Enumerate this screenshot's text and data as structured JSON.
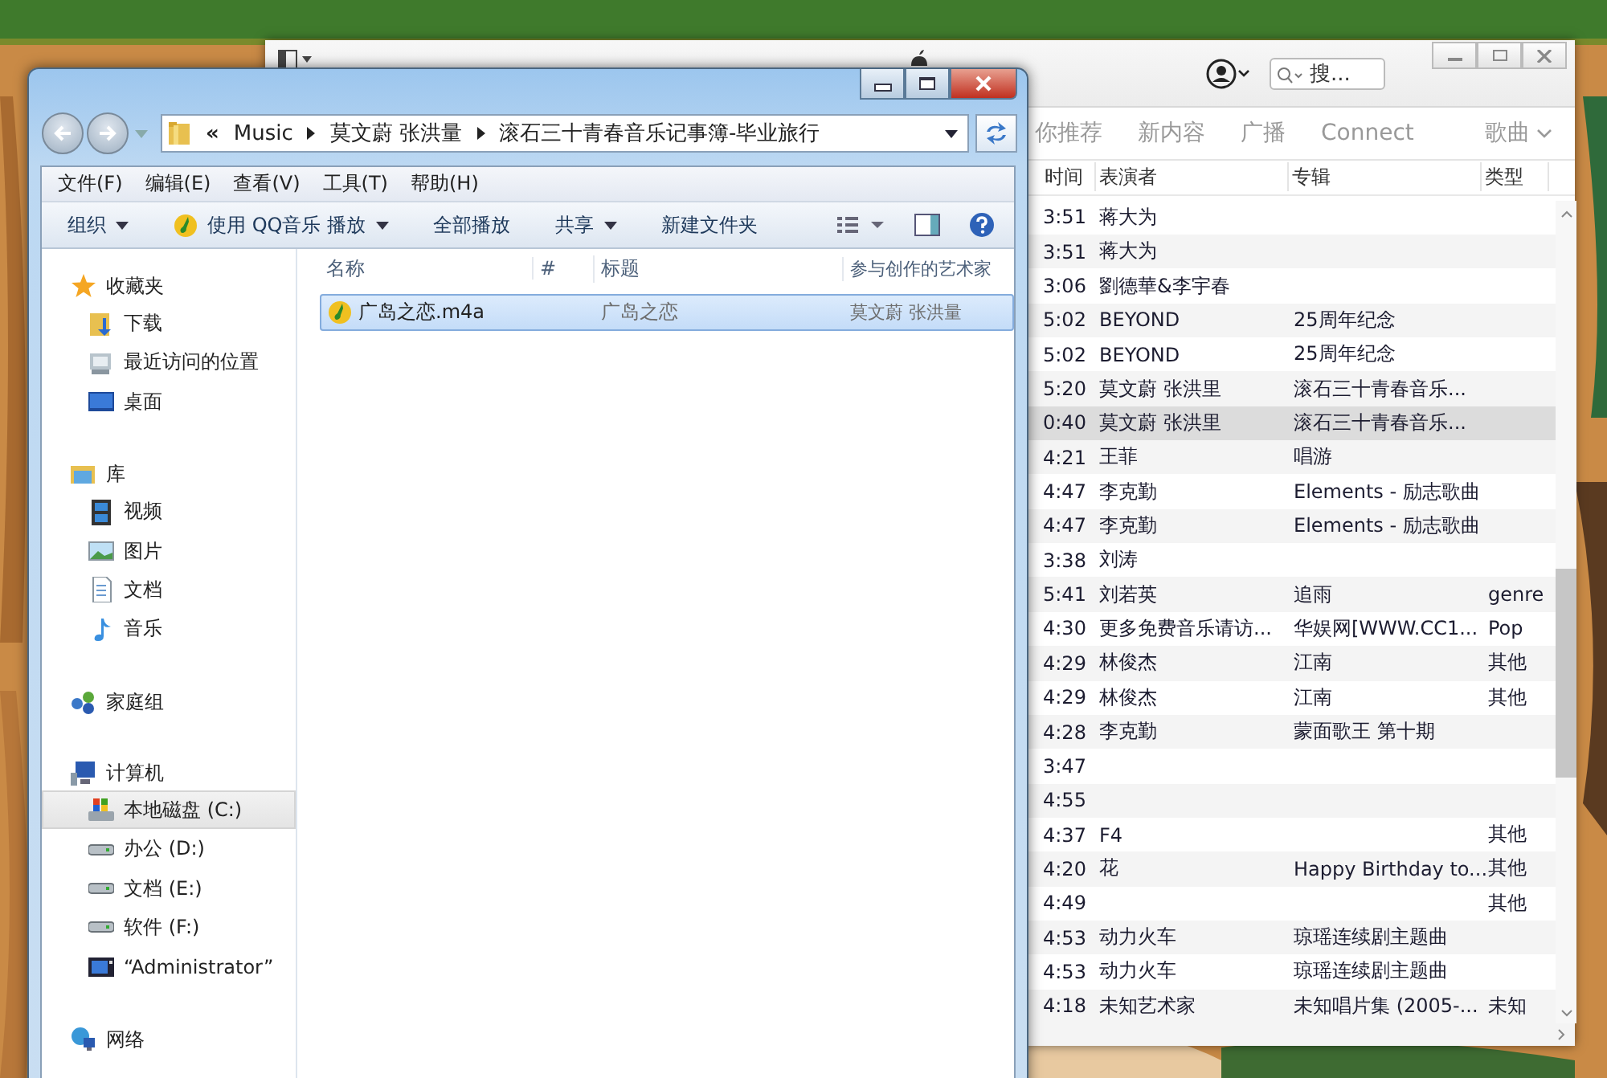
{
  "itunes": {
    "search": {
      "placeholder": "搜..."
    },
    "nav": [
      {
        "label": "你推荐",
        "selected": false
      },
      {
        "label": "新内容",
        "selected": false
      },
      {
        "label": "广播",
        "selected": false
      },
      {
        "label": "Connect",
        "selected": false
      }
    ],
    "view_menu": {
      "label": "歌曲"
    },
    "columns": [
      "时间",
      "表演者",
      "专辑",
      "类型"
    ],
    "rows": [
      {
        "time": "3:51",
        "artist": "蒋大为",
        "album": "",
        "genre": "",
        "selected": false
      },
      {
        "time": "3:51",
        "artist": "蒋大为",
        "album": "",
        "genre": "",
        "selected": false
      },
      {
        "time": "3:06",
        "artist": "劉德華&李宇春",
        "album": "",
        "genre": "",
        "selected": false
      },
      {
        "time": "5:02",
        "artist": "BEYOND",
        "album": "25周年纪念",
        "genre": "",
        "selected": false
      },
      {
        "time": "5:02",
        "artist": "BEYOND",
        "album": "25周年纪念",
        "genre": "",
        "selected": false
      },
      {
        "time": "5:20",
        "artist": "莫文蔚 张洪里",
        "album": "滚石三十青春音乐...",
        "genre": "",
        "selected": false
      },
      {
        "time": "0:40",
        "artist": "莫文蔚 张洪里",
        "album": "滚石三十青春音乐...",
        "genre": "",
        "selected": true
      },
      {
        "time": "4:21",
        "artist": "王菲",
        "album": "唱游",
        "genre": "",
        "selected": false
      },
      {
        "time": "4:47",
        "artist": "李克勤",
        "album": "Elements - 励志歌曲",
        "genre": "",
        "selected": false
      },
      {
        "time": "4:47",
        "artist": "李克勤",
        "album": "Elements - 励志歌曲",
        "genre": "",
        "selected": false
      },
      {
        "time": "3:38",
        "artist": "刘涛",
        "album": "",
        "genre": "",
        "selected": false
      },
      {
        "time": "5:41",
        "artist": "刘若英",
        "album": "追雨",
        "genre": "genre",
        "selected": false
      },
      {
        "time": "4:30",
        "artist": "更多免费音乐请访...",
        "album": "华娱网[WWW.CC1...",
        "genre": "Pop",
        "selected": false
      },
      {
        "time": "4:29",
        "artist": "林俊杰",
        "album": "江南",
        "genre": "其他",
        "selected": false
      },
      {
        "time": "4:29",
        "artist": "林俊杰",
        "album": "江南",
        "genre": "其他",
        "selected": false
      },
      {
        "time": "4:28",
        "artist": "李克勤",
        "album": "蒙面歌王 第十期",
        "genre": "",
        "selected": false
      },
      {
        "time": "3:47",
        "artist": "",
        "album": "",
        "genre": "",
        "selected": false
      },
      {
        "time": "4:55",
        "artist": "",
        "album": "",
        "genre": "",
        "selected": false
      },
      {
        "time": "4:37",
        "artist": "F4",
        "album": "",
        "genre": "其他",
        "selected": false
      },
      {
        "time": "4:20",
        "artist": "花",
        "album": "Happy Birthday to...",
        "genre": "其他",
        "selected": false
      },
      {
        "time": "4:49",
        "artist": "",
        "album": "",
        "genre": "其他",
        "selected": false
      },
      {
        "time": "4:53",
        "artist": "动力火车",
        "album": "琼瑶连续剧主题曲",
        "genre": "",
        "selected": false
      },
      {
        "time": "4:53",
        "artist": "动力火车",
        "album": "琼瑶连续剧主题曲",
        "genre": "",
        "selected": false
      },
      {
        "time": "4:18",
        "artist": "未知艺术家",
        "album": "未知唱片集 (2005-...",
        "genre": "未知",
        "selected": false
      }
    ]
  },
  "explorer": {
    "breadcrumb_overflow": "«",
    "breadcrumb": [
      "Music",
      "莫文蔚 张洪量",
      "滚石三十青春音乐记事簿-毕业旅行"
    ],
    "menu": [
      "文件(F)",
      "编辑(E)",
      "查看(V)",
      "工具(T)",
      "帮助(H)"
    ],
    "toolbar": [
      {
        "label": "组织",
        "kind": "plain",
        "dropdown": true
      },
      {
        "label": "使用 QQ音乐 播放",
        "kind": "app",
        "dropdown": true
      },
      {
        "label": "全部播放",
        "kind": "plain",
        "dropdown": false
      },
      {
        "label": "共享",
        "kind": "plain",
        "dropdown": true
      },
      {
        "label": "新建文件夹",
        "kind": "plain",
        "dropdown": false
      }
    ],
    "sidebar": [
      {
        "label": "收藏夹",
        "children": [
          {
            "label": "下载",
            "selected": false
          },
          {
            "label": "最近访问的位置",
            "selected": false
          },
          {
            "label": "桌面",
            "selected": false
          }
        ]
      },
      {
        "label": "库",
        "children": [
          {
            "label": "视频",
            "selected": false
          },
          {
            "label": "图片",
            "selected": false
          },
          {
            "label": "文档",
            "selected": false
          },
          {
            "label": "音乐",
            "selected": false
          }
        ]
      },
      {
        "label": "家庭组"
      },
      {
        "label": "计算机",
        "children": [
          {
            "label": "本地磁盘 (C:)",
            "selected": true
          },
          {
            "label": "办公 (D:)",
            "selected": false
          },
          {
            "label": "文档 (E:)",
            "selected": false
          },
          {
            "label": "软件 (F:)",
            "selected": false
          },
          {
            "label": "“Administrator”",
            "selected": false
          }
        ]
      },
      {
        "label": "网络"
      }
    ],
    "columns": [
      "名称",
      "#",
      "标题",
      "参与创作的艺术家"
    ],
    "files": [
      {
        "name": "广岛之恋.m4a",
        "title": "广岛之恋",
        "artist": "莫文蔚 张洪量",
        "selected": true
      }
    ]
  }
}
